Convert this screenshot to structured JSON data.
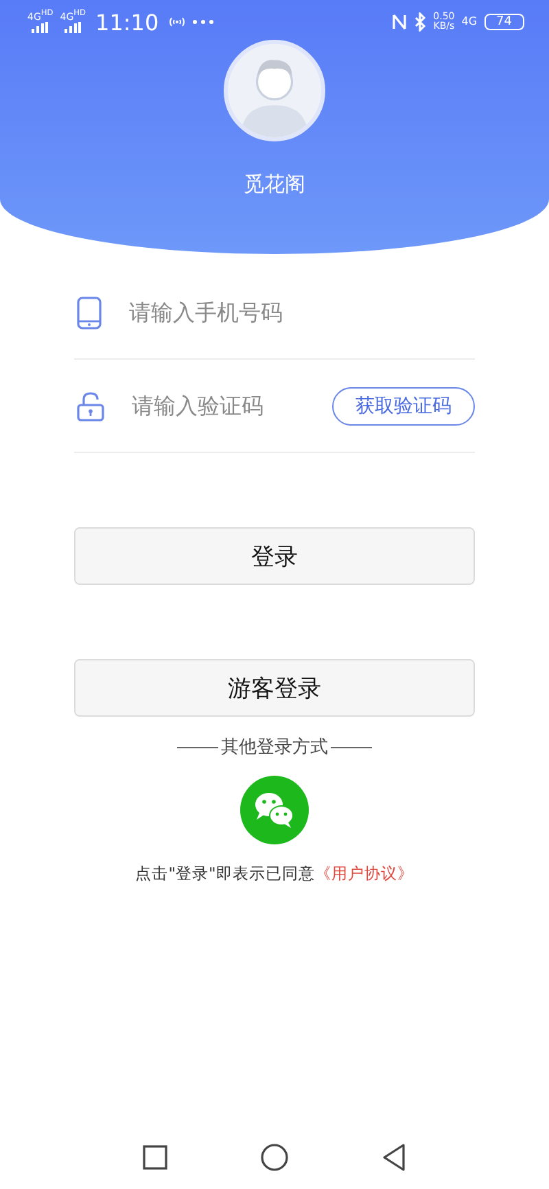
{
  "status_bar": {
    "networks": [
      "4G$^{HD}$",
      "4G$^{HD}$"
    ],
    "time": "11:10",
    "speed": "0.50",
    "speed_unit": "KB/s",
    "mobile": "4G",
    "battery": "74"
  },
  "profile": {
    "name": "觅花阁"
  },
  "form": {
    "phone": {
      "placeholder": "请输入手机号码"
    },
    "code": {
      "placeholder": "请输入验证码",
      "button": "获取验证码"
    }
  },
  "buttons": [
    {
      "label": "登录"
    },
    {
      "label": "游客登录"
    }
  ],
  "other_login": {
    "title": "其他登录方式"
  },
  "agreement": {
    "text": "点击\"登录\"即表示已同意",
    "link": "《用户协议》"
  }
}
